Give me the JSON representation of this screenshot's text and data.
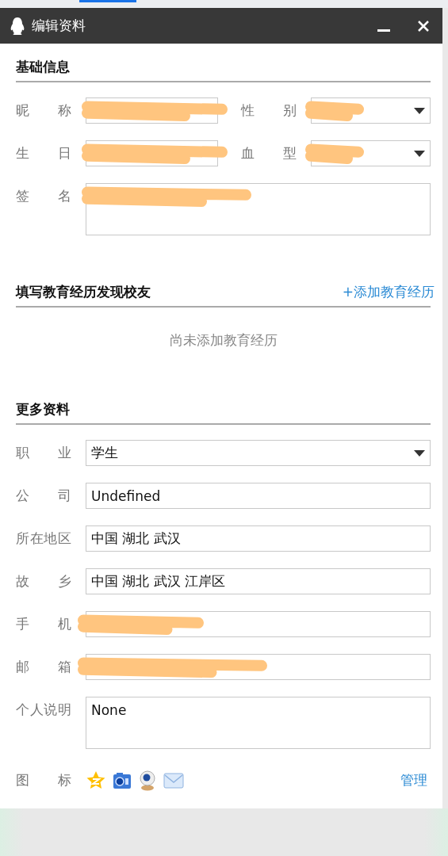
{
  "window": {
    "title": "编辑资料"
  },
  "basic": {
    "title": "基础信息",
    "rows": [
      [
        {
          "label": "昵称",
          "kind": "text",
          "redacted": true
        },
        {
          "label": "性别",
          "kind": "select",
          "redacted": true
        }
      ],
      [
        {
          "label": "生日",
          "kind": "text",
          "redacted": true
        },
        {
          "label": "血型",
          "kind": "select",
          "redacted": true
        }
      ],
      [
        {
          "label": "签名",
          "kind": "textarea",
          "redacted": true
        }
      ]
    ]
  },
  "education": {
    "title": "填写教育经历发现校友",
    "action": "+添加教育经历",
    "empty": "尚未添加教育经历"
  },
  "more": {
    "title": "更多资料",
    "fields": [
      {
        "label": "职业",
        "kind": "select",
        "value": "学生",
        "redacted": false
      },
      {
        "label": "公司",
        "kind": "text",
        "value": "Undefined",
        "redacted": false
      },
      {
        "label": "所在地区",
        "kind": "text",
        "value": "中国  湖北  武汉",
        "redacted": false
      },
      {
        "label": "故乡",
        "kind": "text",
        "value": "中国  湖北  武汉  江岸区",
        "redacted": false
      },
      {
        "label": "手机",
        "kind": "text",
        "redacted": true
      },
      {
        "label": "邮箱",
        "kind": "text",
        "redacted": true
      },
      {
        "label": "个人说明",
        "kind": "textarea",
        "value": "None",
        "redacted": false
      }
    ],
    "icons": {
      "label": "图标",
      "action": "管理"
    }
  }
}
